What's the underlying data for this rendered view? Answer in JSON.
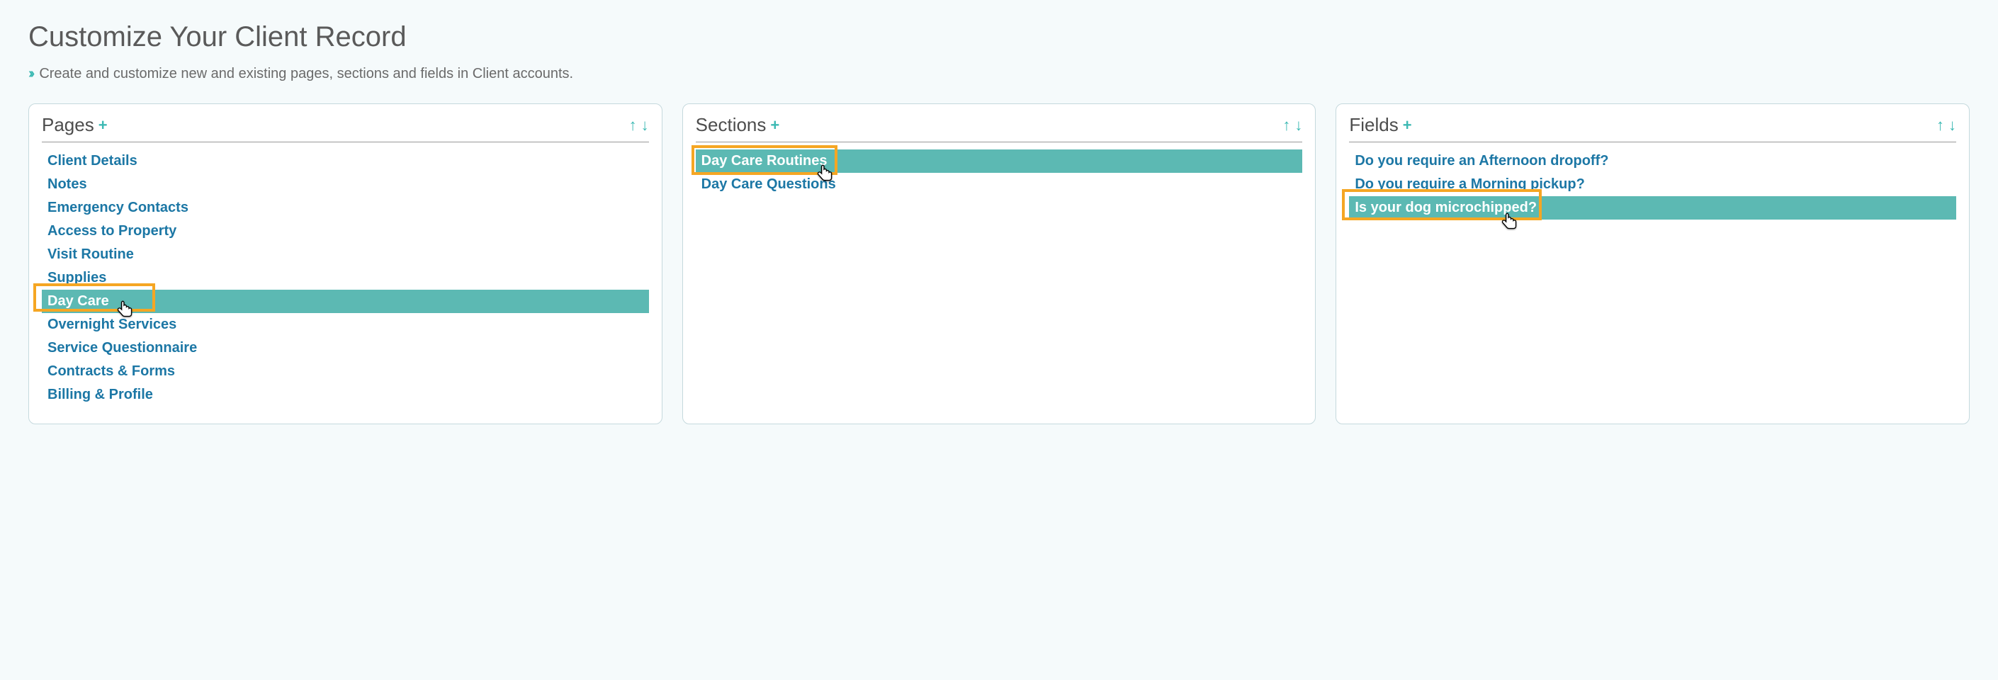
{
  "header": {
    "title": "Customize Your Client Record",
    "subtitle": "Create and customize new and existing pages, sections and fields in Client accounts."
  },
  "panels": {
    "pages": {
      "title": "Pages",
      "items": [
        "Client Details",
        "Notes",
        "Emergency Contacts",
        "Access to Property",
        "Visit Routine",
        "Supplies",
        "Day Care",
        "Overnight Services",
        "Service Questionnaire",
        "Contracts & Forms",
        "Billing & Profile"
      ],
      "selectedIndex": 6
    },
    "sections": {
      "title": "Sections",
      "items": [
        "Day Care Routines",
        "Day Care Questions"
      ],
      "selectedIndex": 0
    },
    "fields": {
      "title": "Fields",
      "items": [
        "Do you require an Afternoon dropoff?",
        "Do you require a Morning pickup?",
        "Is your dog microchipped?"
      ],
      "selectedIndex": 2
    }
  }
}
